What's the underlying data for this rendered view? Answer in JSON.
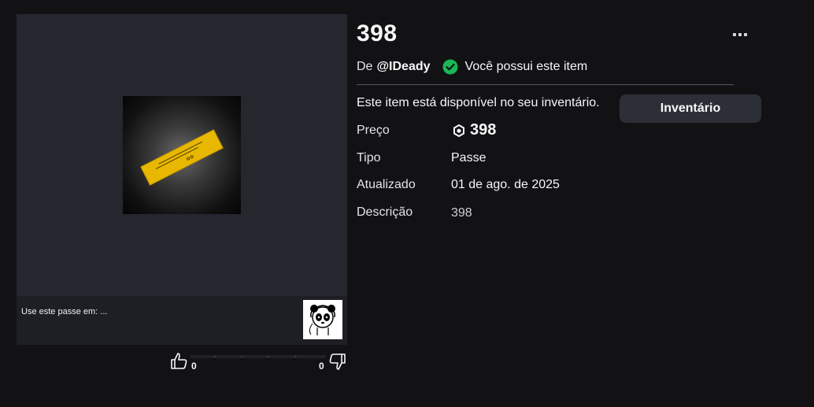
{
  "item": {
    "title": "398",
    "by_prefix": "De",
    "creator": "@IDeady",
    "owned_text": "Você possui este item",
    "available_text": "Este item está disponível no seu inventário.",
    "inventory_button": "Inventário"
  },
  "details": {
    "price_label": "Preço",
    "price_value": "398",
    "type_label": "Tipo",
    "type_value": "Passe",
    "updated_label": "Atualizado",
    "updated_value": "01 de ago. de 2025",
    "description_label": "Descrição",
    "description_value": "398"
  },
  "usage": {
    "label": "Use este passe em: ..."
  },
  "votes": {
    "up": "0",
    "down": "0"
  },
  "icons": {
    "more": "more-horizontal-icon",
    "owned": "check-circle-icon",
    "currency": "robux-icon",
    "upvote": "thumbs-up-icon",
    "downvote": "thumbs-down-icon"
  },
  "colors": {
    "background": "#121215",
    "panel": "#24272e",
    "owned_green": "#1ab755",
    "pass_gold": "#e8b800",
    "button": "#2d2f36"
  }
}
